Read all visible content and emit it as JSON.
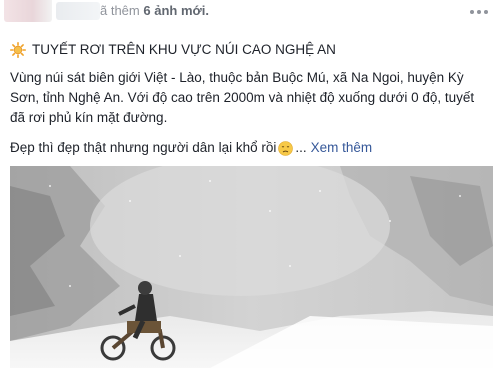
{
  "header": {
    "suffix": "ã thêm",
    "count": "6 ảnh mới.",
    "more_icon": "more-dots-icon"
  },
  "post": {
    "title_icon": "sun-icon",
    "title": "TUYẾT RƠI TRÊN KHU VỰC NÚI CAO NGHỆ AN",
    "body": "Vùng núi sát biên giới Việt - Lào, thuộc bản Buộc Mú, xã Na Ngoi, huyện Kỳ Sơn, tỉnh Nghệ An. Với độ cao trên 2000m và nhiệt độ xuống dưới 0 độ, tuyết đã rơi phủ kín mặt đường.",
    "line2": "Đẹp thì đẹp thật nhưng người dân lại khổ rồi",
    "emoji": "sad-face-icon",
    "ellipsis": "...",
    "see_more": "Xem thêm"
  },
  "colors": {
    "link": "#365899",
    "text": "#1d2129",
    "meta": "#90949c"
  }
}
